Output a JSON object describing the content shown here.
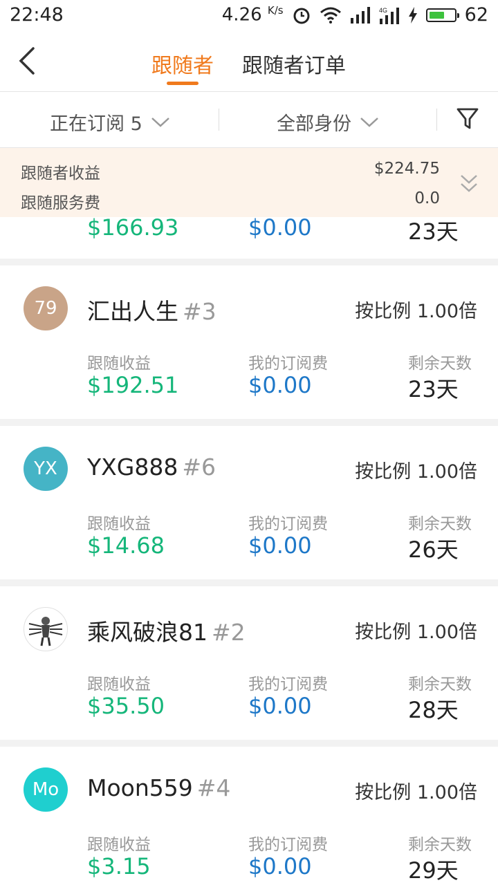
{
  "status_bar": {
    "time": "22:48",
    "net_speed": "4.26",
    "net_unit": "K/s",
    "battery_level": "62",
    "battery_fill_fraction": 0.62,
    "icons": [
      "alarm-icon",
      "wifi-icon",
      "signal-icon",
      "signal-4g-icon",
      "charging-icon",
      "battery-icon"
    ]
  },
  "nav": {
    "back_icon": "back-arrow-icon",
    "tabs": [
      {
        "label": "跟随者",
        "active": true
      },
      {
        "label": "跟随者订单",
        "active": false
      }
    ],
    "accent_color": "#f07a1d"
  },
  "filters": {
    "subscription": "正在订阅 5",
    "identity": "全部身份",
    "filter_icon": "funnel-icon"
  },
  "summary": {
    "rows": [
      {
        "label": "跟随者收益",
        "value": "$224.75"
      },
      {
        "label": "跟随服务费",
        "value": "0.0"
      }
    ],
    "expand_icon": "double-chevron-down-icon"
  },
  "partial_card": {
    "follow_profit": "$166.93",
    "sub_fee": "$0.00",
    "days_left": "23天"
  },
  "column_labels": {
    "follow_profit": "跟随收益",
    "sub_fee": "我的订阅费",
    "days_left": "剩余天数"
  },
  "followers": [
    {
      "avatar_text": "79",
      "avatar_color": "#c9a488",
      "name": "汇出人生",
      "rank": "#3",
      "ratio": "按比例 1.00倍",
      "follow_profit": "$192.51",
      "sub_fee": "$0.00",
      "days_left": "23天"
    },
    {
      "avatar_text": "YX",
      "avatar_color": "#45b4c6",
      "name": "YXG888",
      "rank": "#6",
      "ratio": "按比例 1.00倍",
      "follow_profit": "$14.68",
      "sub_fee": "$0.00",
      "days_left": "26天"
    },
    {
      "avatar_text": "",
      "avatar_color": "#ffffff",
      "name": "乘风破浪81",
      "rank": "#2",
      "ratio": "按比例 1.00倍",
      "follow_profit": "$35.50",
      "sub_fee": "$0.00",
      "days_left": "28天"
    },
    {
      "avatar_text": "Mo",
      "avatar_color": "#1fcfcf",
      "name": "Moon559",
      "rank": "#4",
      "ratio": "按比例 1.00倍",
      "follow_profit": "$3.15",
      "sub_fee": "$0.00",
      "days_left": "29天"
    }
  ],
  "colors": {
    "profit": "#15b67a",
    "fee": "#1e78c8",
    "summary_bg": "#fdf3ea"
  }
}
